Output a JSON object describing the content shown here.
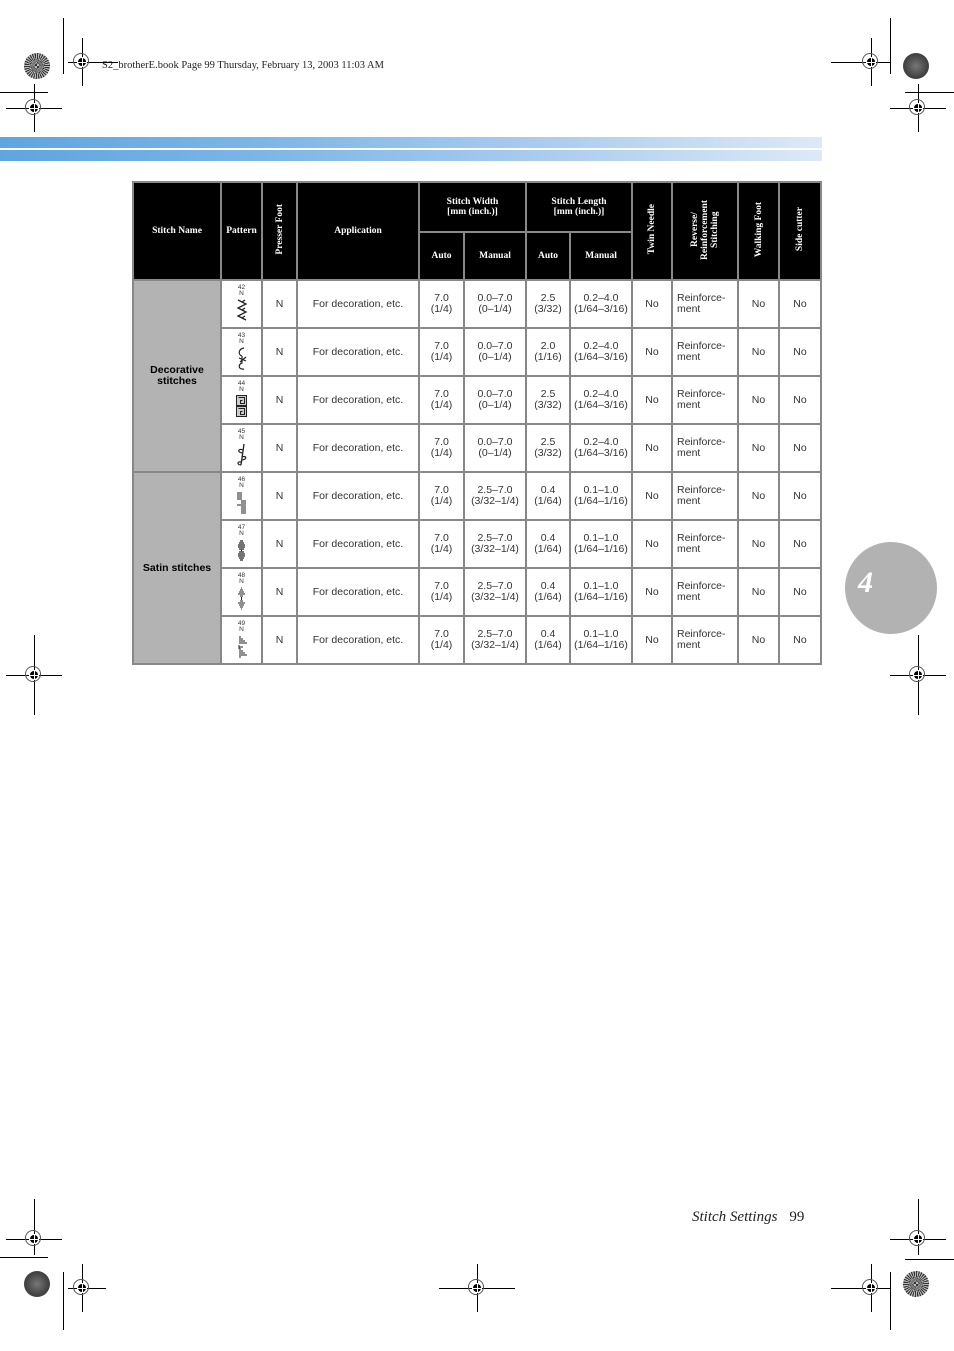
{
  "print_header": "S2_brotherE.book  Page 99  Thursday, February 13, 2003  11:03 AM",
  "table": {
    "headers": {
      "stitch_name": "Stitch Name",
      "pattern": "Pattern",
      "presser_foot": "Presser Foot",
      "application": "Application",
      "stitch_width": "Stitch Width",
      "stitch_width_unit": "[mm (inch.)]",
      "stitch_length": "Stitch Length",
      "stitch_length_unit": "[mm (inch.)]",
      "auto": "Auto",
      "manual": "Manual",
      "twin_needle": "Twin Needle",
      "reverse_1": "Reverse/",
      "reverse_2": "Reinforcement",
      "reverse_3": "Stitching",
      "walking_foot": "Walking Foot",
      "side_cutter": "Side cutter"
    },
    "groups": {
      "decorative": "Decorative stitches",
      "satin": "Satin stitches"
    },
    "rows": [
      {
        "num": "42",
        "foot_code": "N",
        "icon": "leaf-zigzag-stitch-icon",
        "presser_foot": "N",
        "application": "For decoration, etc.",
        "w_auto": "7.0",
        "w_auto_in": "(1/4)",
        "w_manual": "0.0–7.0",
        "w_manual_in": "(0–1/4)",
        "l_auto": "2.5",
        "l_auto_in": "(3/32)",
        "l_manual": "0.2–4.0",
        "l_manual_in": "(1/64–3/16)",
        "twin": "No",
        "reverse_1": "Reinforce-",
        "reverse_2": "ment",
        "walking": "No",
        "side": "No"
      },
      {
        "num": "43",
        "foot_code": "N",
        "icon": "scroll-stitch-icon",
        "presser_foot": "N",
        "application": "For decoration, etc.",
        "w_auto": "7.0",
        "w_auto_in": "(1/4)",
        "w_manual": "0.0–7.0",
        "w_manual_in": "(0–1/4)",
        "l_auto": "2.0",
        "l_auto_in": "(1/16)",
        "l_manual": "0.2–4.0",
        "l_manual_in": "(1/64–3/16)",
        "twin": "No",
        "reverse_1": "Reinforce-",
        "reverse_2": "ment",
        "walking": "No",
        "side": "No"
      },
      {
        "num": "44",
        "foot_code": "N",
        "icon": "greek-key-stitch-icon",
        "presser_foot": "N",
        "application": "For decoration, etc.",
        "w_auto": "7.0",
        "w_auto_in": "(1/4)",
        "w_manual": "0.0–7.0",
        "w_manual_in": "(0–1/4)",
        "l_auto": "2.5",
        "l_auto_in": "(3/32)",
        "l_manual": "0.2–4.0",
        "l_manual_in": "(1/64–3/16)",
        "twin": "No",
        "reverse_1": "Reinforce-",
        "reverse_2": "ment",
        "walking": "No",
        "side": "No"
      },
      {
        "num": "45",
        "foot_code": "N",
        "icon": "vine-stitch-icon",
        "presser_foot": "N",
        "application": "For decoration, etc.",
        "w_auto": "7.0",
        "w_auto_in": "(1/4)",
        "w_manual": "0.0–7.0",
        "w_manual_in": "(0–1/4)",
        "l_auto": "2.5",
        "l_auto_in": "(3/32)",
        "l_manual": "0.2–4.0",
        "l_manual_in": "(1/64–3/16)",
        "twin": "No",
        "reverse_1": "Reinforce-",
        "reverse_2": "ment",
        "walking": "No",
        "side": "No"
      },
      {
        "num": "46",
        "foot_code": "N",
        "icon": "step-satin-stitch-icon",
        "presser_foot": "N",
        "application": "For decoration, etc.",
        "w_auto": "7.0",
        "w_auto_in": "(1/4)",
        "w_manual": "2.5–7.0",
        "w_manual_in": "(3/32–1/4)",
        "l_auto": "0.4",
        "l_auto_in": "(1/64)",
        "l_manual": "0.1–1.0",
        "l_manual_in": "(1/64–1/16)",
        "twin": "No",
        "reverse_1": "Reinforce-",
        "reverse_2": "ment",
        "walking": "No",
        "side": "No"
      },
      {
        "num": "47",
        "foot_code": "N",
        "icon": "oval-satin-stitch-icon",
        "presser_foot": "N",
        "application": "For decoration, etc.",
        "w_auto": "7.0",
        "w_auto_in": "(1/4)",
        "w_manual": "2.5–7.0",
        "w_manual_in": "(3/32–1/4)",
        "l_auto": "0.4",
        "l_auto_in": "(1/64)",
        "l_manual": "0.1–1.0",
        "l_manual_in": "(1/64–1/16)",
        "twin": "No",
        "reverse_1": "Reinforce-",
        "reverse_2": "ment",
        "walking": "No",
        "side": "No"
      },
      {
        "num": "48",
        "foot_code": "N",
        "icon": "diamond-satin-stitch-icon",
        "presser_foot": "N",
        "application": "For decoration, etc.",
        "w_auto": "7.0",
        "w_auto_in": "(1/4)",
        "w_manual": "2.5–7.0",
        "w_manual_in": "(3/32–1/4)",
        "l_auto": "0.4",
        "l_auto_in": "(1/64)",
        "l_manual": "0.1–1.0",
        "l_manual_in": "(1/64–1/16)",
        "twin": "No",
        "reverse_1": "Reinforce-",
        "reverse_2": "ment",
        "walking": "No",
        "side": "No"
      },
      {
        "num": "49",
        "foot_code": "N",
        "icon": "wedge-satin-stitch-icon",
        "presser_foot": "N",
        "application": "For decoration, etc.",
        "w_auto": "7.0",
        "w_auto_in": "(1/4)",
        "w_manual": "2.5–7.0",
        "w_manual_in": "(3/32–1/4)",
        "l_auto": "0.4",
        "l_auto_in": "(1/64)",
        "l_manual": "0.1–1.0",
        "l_manual_in": "(1/64–1/16)",
        "twin": "No",
        "reverse_1": "Reinforce-",
        "reverse_2": "ment",
        "walking": "No",
        "side": "No"
      }
    ]
  },
  "chapter_tab": "4",
  "footer": {
    "section_title": "Stitch Settings",
    "page_number": "99"
  },
  "colors": {
    "stripe_start": "#5fa5e0",
    "stripe_end": "#dde9f7",
    "header_bg": "#000000",
    "group_bg": "#b3b3b3",
    "chapter_bg": "#b2b2b2"
  }
}
